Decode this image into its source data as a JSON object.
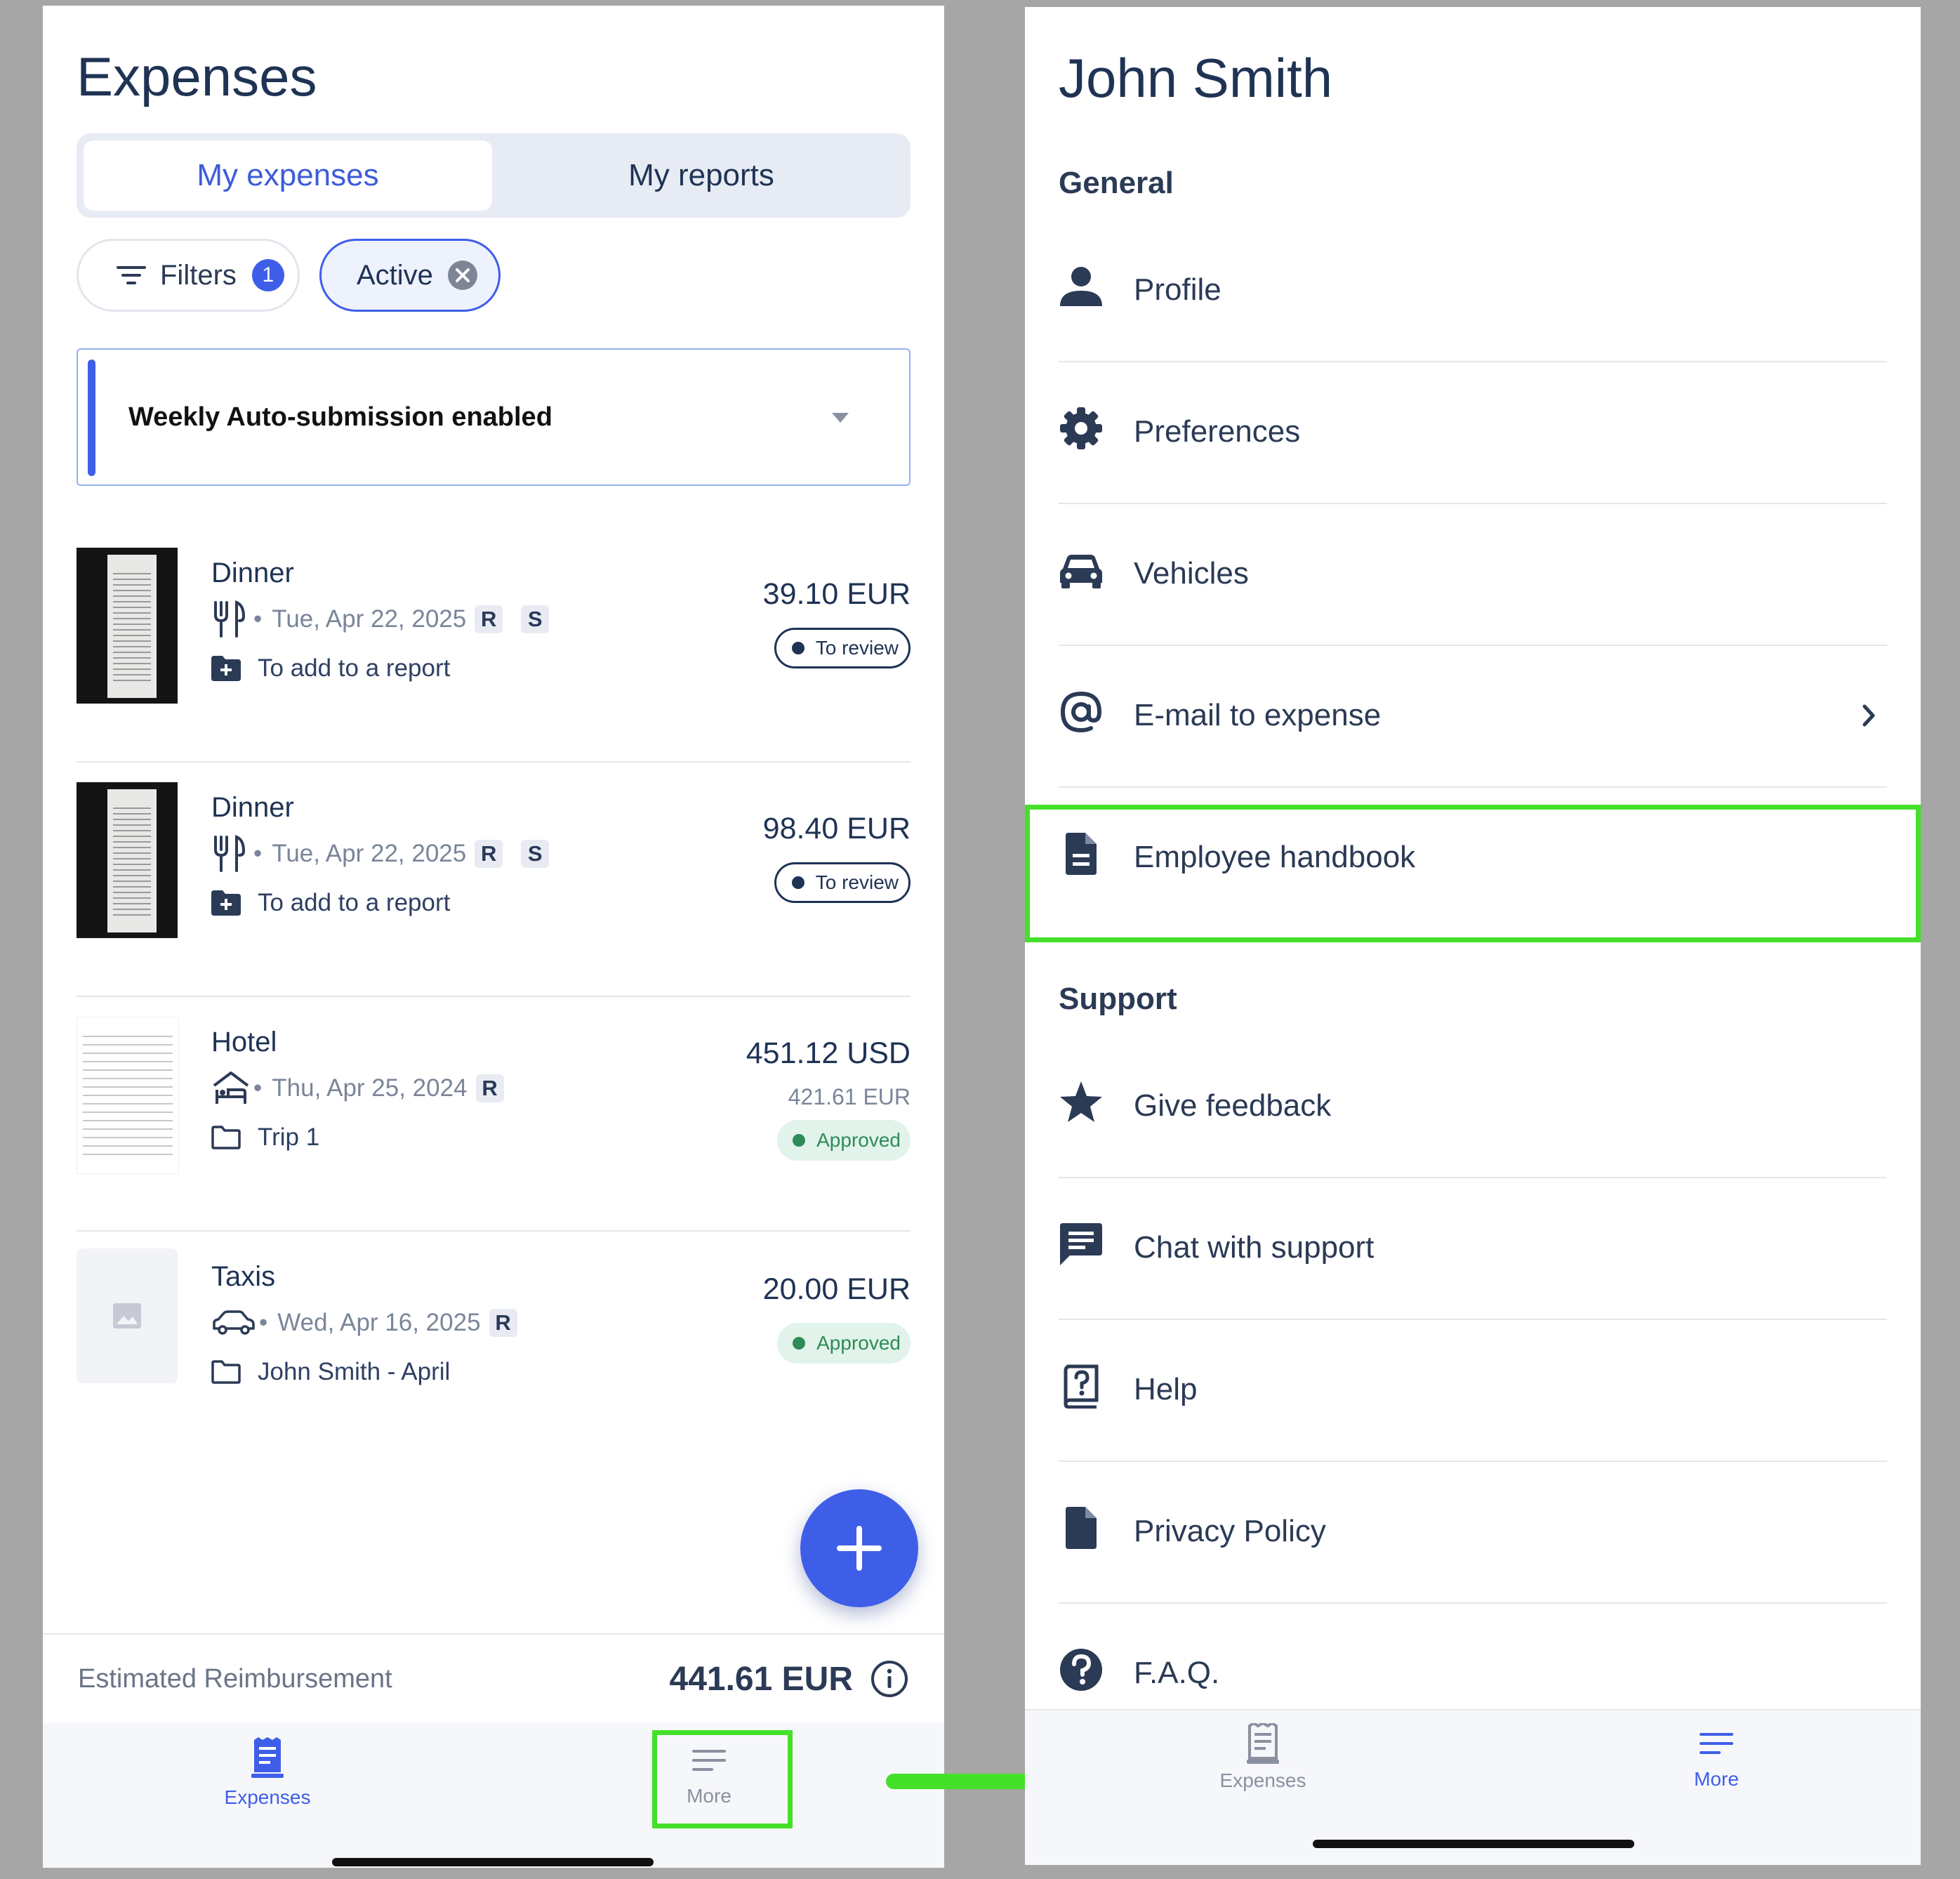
{
  "expenses_screen": {
    "title": "Expenses",
    "tabs": {
      "active": "My expenses",
      "inactive": "My reports"
    },
    "filters": {
      "label": "Filters",
      "count": "1"
    },
    "active_chip": {
      "label": "Active"
    },
    "banner": {
      "text": "Weekly Auto-submission enabled"
    },
    "expenses": [
      {
        "title": "Dinner",
        "date": "Tue, Apr 22, 2025",
        "tags": [
          "R",
          "S"
        ],
        "report": "To add to a report",
        "amount": "39.10 EUR",
        "status": "To review"
      },
      {
        "title": "Dinner",
        "date": "Tue, Apr 22, 2025",
        "tags": [
          "R",
          "S"
        ],
        "report": "To add to a report",
        "amount": "98.40 EUR",
        "status": "To review"
      },
      {
        "title": "Hotel",
        "date": "Thu, Apr 25, 2024",
        "tags": [
          "R"
        ],
        "report": "Trip 1",
        "amount": "451.12 USD",
        "converted": "421.61  EUR",
        "status": "Approved"
      },
      {
        "title": "Taxis",
        "date": "Wed, Apr 16, 2025",
        "tags": [
          "R"
        ],
        "report": "John Smith - April",
        "amount": "20.00 EUR",
        "status": "Approved"
      }
    ],
    "reimbursement": {
      "label": "Estimated Reimbursement",
      "amount": "441.61 EUR"
    },
    "tabbar": {
      "expenses": "Expenses",
      "more": "More"
    }
  },
  "more_screen": {
    "title": "John Smith",
    "general_header": "General",
    "general_items": [
      "Profile",
      "Preferences",
      "Vehicles",
      "E-mail to expense",
      "Employee handbook"
    ],
    "support_header": "Support",
    "support_items": [
      "Give feedback",
      "Chat with support",
      "Help",
      "Privacy Policy",
      "F.A.Q."
    ],
    "tabbar": {
      "expenses": "Expenses",
      "more": "More"
    }
  },
  "colors": {
    "accent": "#3f5ee8",
    "highlight": "#44e02a",
    "text": "#1f3354",
    "approved": "#2e8b57"
  },
  "icons": [
    "filter-icon",
    "close-circle-icon",
    "chevron-down-icon",
    "fork-knife-icon",
    "folder-plus-icon",
    "hotel-icon",
    "car-icon",
    "folder-icon",
    "image-placeholder-icon",
    "plus-icon",
    "info-icon",
    "receipt-icon",
    "menu-icon",
    "person-icon",
    "gear-icon",
    "at-icon",
    "chevron-right-icon",
    "document-icon",
    "star-icon",
    "chat-icon",
    "help-book-icon",
    "file-icon",
    "question-circle-icon",
    "arrow-right-icon"
  ]
}
